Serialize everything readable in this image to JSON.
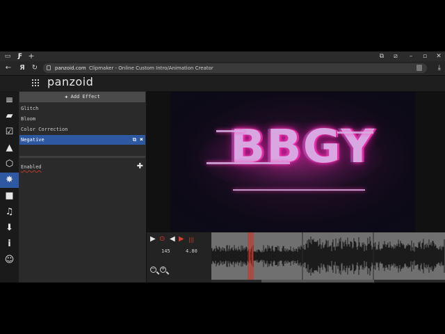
{
  "browser": {
    "url_domain": "panzoid.com",
    "page_title": "Clipmaker - Online Custom Intro/Animation Creator"
  },
  "app": {
    "logo": "panzoid"
  },
  "sidebar_icons": [
    "menu-icon",
    "folder-icon",
    "edit-icon",
    "image-icon",
    "box-3d-icon",
    "effects-icon",
    "camera-icon",
    "music-icon",
    "download-icon",
    "info-icon",
    "smiley-icon"
  ],
  "effects_panel": {
    "add_label": "Add Effect",
    "items": [
      {
        "label": "Glitch",
        "selected": false
      },
      {
        "label": "Bloom",
        "selected": false
      },
      {
        "label": "Color Correction",
        "selected": false
      },
      {
        "label": "Negative",
        "selected": true
      }
    ],
    "property_label": "Enabled"
  },
  "preview": {
    "text": "BBGY",
    "glow_color": "#ff3ab5",
    "text_color": "#d8a6e0"
  },
  "timeline": {
    "frame": "145",
    "time": "4.80",
    "accent_color": "#d63b2f"
  }
}
